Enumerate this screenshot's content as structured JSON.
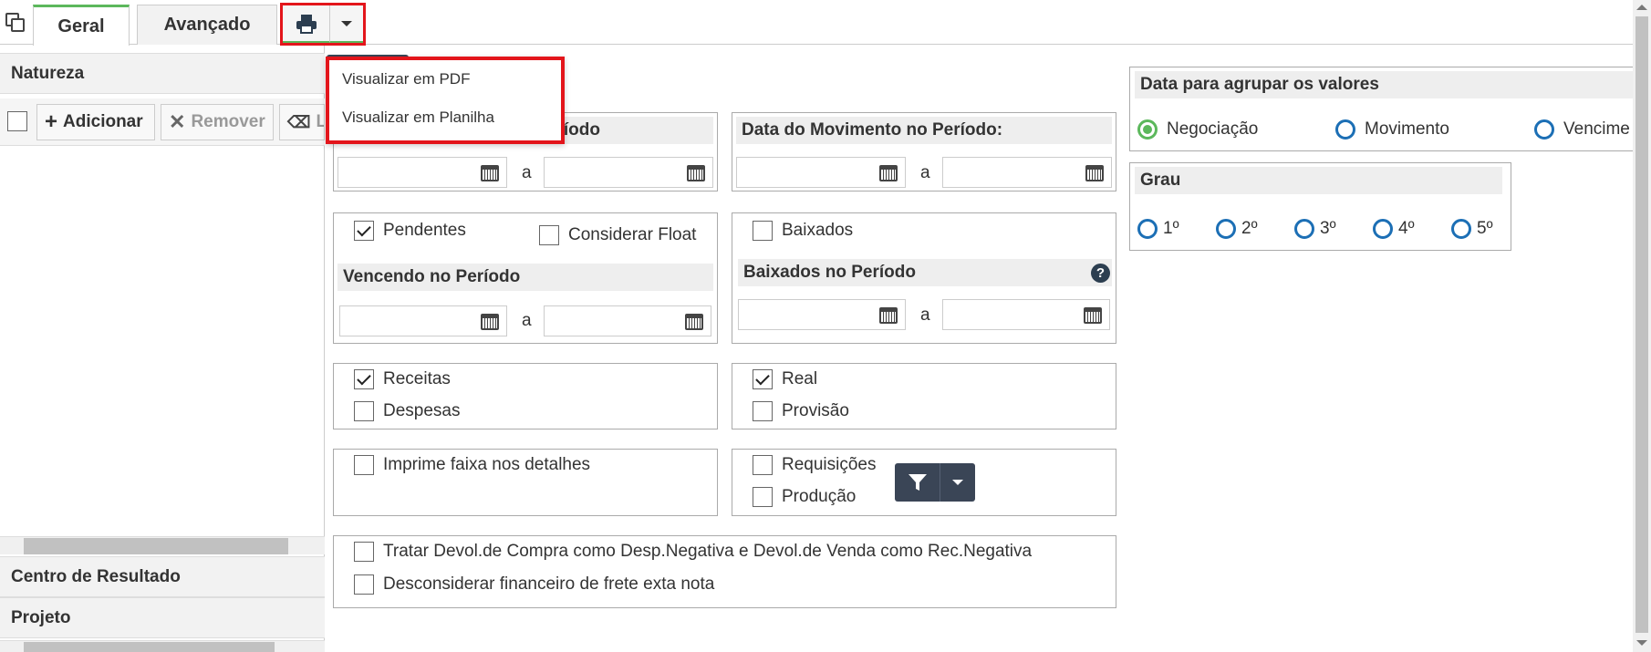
{
  "tabs": {
    "geral": "Geral",
    "avancado": "Avançado"
  },
  "print_menu": {
    "pdf": "Visualizar em PDF",
    "planilha": "Visualizar em Planilha"
  },
  "left": {
    "natureza": "Natureza",
    "adicionar": "Adicionar",
    "remover": "Remover",
    "limpar": "Li",
    "centro": "Centro de Resultado",
    "projeto": "Projeto"
  },
  "periodo": {
    "title_partial": "íodo",
    "movimento_title": "Data do Movimento no Período:",
    "sep": "a"
  },
  "pendentes": {
    "pendentes": "Pendentes",
    "considerar_float": "Considerar Float",
    "vencendo_title": "Vencendo no Período",
    "sep": "a"
  },
  "baixados": {
    "baixados": "Baixados",
    "baixados_title": "Baixados no Período",
    "help": "?",
    "sep": "a"
  },
  "tipo": {
    "receitas": "Receitas",
    "despesas": "Despesas"
  },
  "real": {
    "real": "Real",
    "provisao": "Provisão"
  },
  "imprime": {
    "label": "Imprime faixa nos detalhes"
  },
  "req": {
    "requisicoes": "Requisições",
    "producao": "Produção"
  },
  "tratar": {
    "devol": "Tratar Devol.de Compra como Desp.Negativa e Devol.de Venda como Rec.Negativa",
    "frete": "Desconsiderar financeiro de frete exta nota"
  },
  "agrupar": {
    "title": "Data para agrupar os valores",
    "negociacao": "Negociação",
    "movimento": "Movimento",
    "vencimento": "Vencime"
  },
  "grau": {
    "title": "Grau",
    "g1": "1º",
    "g2": "2º",
    "g3": "3º",
    "g4": "4º",
    "g5": "5º"
  },
  "colors": {
    "accent_green": "#5cb85c",
    "radio_blue": "#1c6fb5",
    "highlight_red": "#e3151b",
    "filter_btn": "#3a4556"
  }
}
